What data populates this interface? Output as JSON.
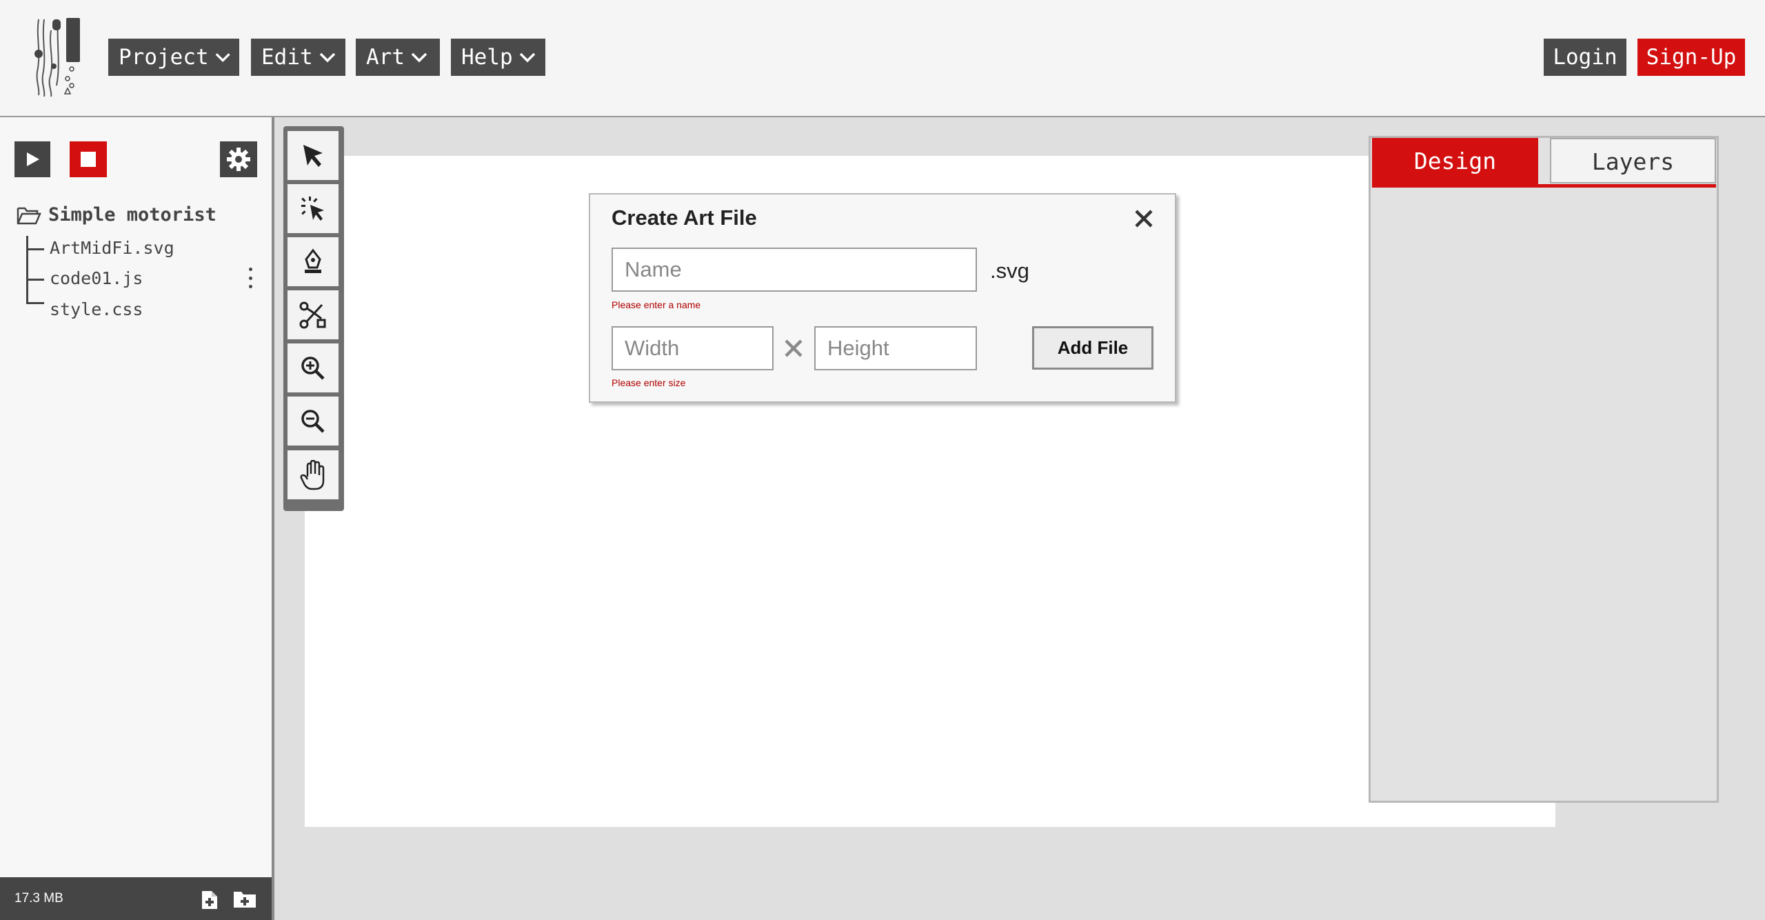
{
  "header": {
    "menus": [
      {
        "label": "Project"
      },
      {
        "label": "Edit"
      },
      {
        "label": "Art"
      },
      {
        "label": "Help"
      }
    ],
    "login_label": "Login",
    "signup_label": "Sign-Up"
  },
  "sidebar": {
    "project_name": "Simple motorist",
    "files": [
      "ArtMidFi.svg",
      "code01.js",
      "style.css"
    ],
    "storage": "17.3 MB"
  },
  "tools": [
    "select-arrow-icon",
    "lasso-select-icon",
    "pen-tool-icon",
    "node-edit-icon",
    "zoom-in-icon",
    "zoom-out-icon",
    "pan-hand-icon"
  ],
  "panel": {
    "tabs": [
      {
        "label": "Design",
        "active": true
      },
      {
        "label": "Layers",
        "active": false
      }
    ]
  },
  "dialog": {
    "title": "Create Art File",
    "name_placeholder": "Name",
    "extension": ".svg",
    "name_error": "Please enter a name",
    "width_placeholder": "Width",
    "height_placeholder": "Height",
    "size_error": "Please enter size",
    "add_button": "Add File"
  },
  "colors": {
    "accent": "#d30f0f",
    "dark": "#4a4a4a",
    "background": "#dfdfdf"
  }
}
